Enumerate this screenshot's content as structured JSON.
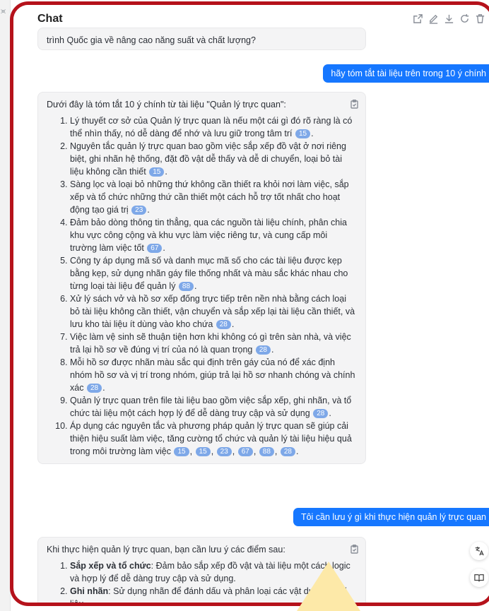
{
  "window": {
    "title": "Chat"
  },
  "messages": {
    "prev_tail": "trình Quốc gia về nâng cao năng suất và chất lượng?",
    "user1": "hãy tóm tắt tài liệu trên trong 10 ý chính",
    "assistant1": {
      "intro": "Dưới đây là tóm tắt 10 ý chính từ tài liệu \"Quản lý trực quan\":",
      "points": [
        {
          "text": "Lý thuyết cơ sở của Quản lý trực quan là nếu một cái gì đó rõ ràng là có thể nhìn thấy, nó dễ dàng để nhớ và lưu giữ trong tâm trí",
          "cites": [
            "15"
          ]
        },
        {
          "text": "Nguyên tắc quản lý trực quan bao gồm việc sắp xếp đồ vật ở nơi riêng biệt, ghi nhãn hệ thống, đặt đồ vật dễ thấy và dễ di chuyển, loại bỏ tài liệu không cần thiết",
          "cites": [
            "15"
          ]
        },
        {
          "text": "Sàng lọc và loại bỏ những thứ không cần thiết ra khỏi nơi làm việc, sắp xếp và tổ chức những thứ cần thiết một cách hỗ trợ tốt nhất cho hoạt động tạo giá trị",
          "cites": [
            "23"
          ]
        },
        {
          "text": "Đảm bảo dòng thông tin thẳng, qua các nguồn tài liệu chính, phân chia khu vực công cộng và khu vực làm việc riêng tư, và cung cấp môi trường làm việc tốt",
          "cites": [
            "67"
          ]
        },
        {
          "text": "Công ty áp dụng mã số và danh mục mã số cho các tài liệu được kẹp bằng kẹp, sử dụng nhãn gáy file thống nhất và màu sắc khác nhau cho từng loại tài liệu để quản lý",
          "cites": [
            "88"
          ]
        },
        {
          "text": "Xử lý sách vở và hồ sơ xếp đống trực tiếp trên nền nhà bằng cách loại bỏ tài liệu không cần thiết, vận chuyển và sắp xếp lại tài liệu cần thiết, và lưu kho tài liệu ít dùng vào kho chứa",
          "cites": [
            "28"
          ]
        },
        {
          "text": "Việc làm vệ sinh sẽ thuận tiện hơn khi không có gì trên sàn nhà, và việc trả lại hồ sơ về đúng vị trí của nó là quan trọng",
          "cites": [
            "28"
          ]
        },
        {
          "text": "Mỗi hồ sơ được nhãn màu sắc qui định trên gáy của nó để xác định nhóm hồ sơ và vị trí trong nhóm, giúp trả lại hồ sơ nhanh chóng và chính xác",
          "cites": [
            "28"
          ]
        },
        {
          "text": "Quản lý trực quan trên file tài liệu bao gồm việc sắp xếp, ghi nhãn, và tổ chức tài liệu một cách hợp lý để dễ dàng truy cập và sử dụng",
          "cites": [
            "28"
          ]
        },
        {
          "text": "Áp dụng các nguyên tắc và phương pháp quản lý trực quan sẽ giúp cải thiện hiệu suất làm việc, tăng cường tổ chức và quản lý tài liệu hiệu quả trong môi trường làm việc",
          "cites": [
            "15",
            "15",
            "23",
            "67",
            "88",
            "28"
          ]
        }
      ]
    },
    "user2": "Tôi cần lưu ý gì khi thực hiện quản lý trực quan",
    "assistant2": {
      "intro": "Khi thực hiện quản lý trực quan, bạn cần lưu ý các điểm sau:",
      "points": [
        {
          "bold": "Sắp xếp và tổ chức",
          "text": ": Đảm bảo sắp xếp đồ vật và tài liệu một cách logic và hợp lý để dễ dàng truy cập và sử dụng."
        },
        {
          "bold": "Ghi nhãn",
          "text": ": Sử dụng nhãn để đánh dấu và phân loại các vật dụng và tài liệu"
        }
      ]
    }
  },
  "icons": [
    "share-icon",
    "edit-icon",
    "download-icon",
    "refresh-icon",
    "trash-icon",
    "clipboard-icon",
    "translate-icon",
    "book-icon",
    "collapse-icon"
  ],
  "colors": {
    "frame": "#b5121b",
    "user_bubble": "#1677ff",
    "citation": "#7ea8e8",
    "assistant_bubble": "#f4f4f5"
  }
}
